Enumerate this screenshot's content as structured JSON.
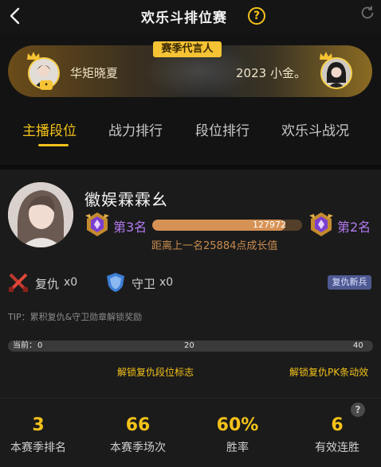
{
  "header": {
    "title": "欢乐斗排位赛"
  },
  "banner": {
    "tag": "赛季代言人",
    "left_name": "华矩晓夏",
    "right_name": "2023 小金。"
  },
  "tabs": [
    {
      "label": "主播段位",
      "active": true
    },
    {
      "label": "战力排行",
      "active": false
    },
    {
      "label": "段位排行",
      "active": false
    },
    {
      "label": "欢乐斗战况",
      "active": false
    }
  ],
  "anchor": {
    "name": "徽娱霖霖幺",
    "current_rank": "第3名",
    "next_rank": "第2名",
    "progress_value": "127972",
    "progress_fraction": 0.89,
    "gap_text": "距离上一名25884点成长值"
  },
  "stats": {
    "revenge_label": "复仇",
    "revenge_count": "x0",
    "guard_label": "守卫",
    "guard_count": "x0",
    "new_badge": "复仇新兵"
  },
  "tip": "TIP：累积复仇&守卫勋章解锁奖励",
  "track": {
    "current_label": "当前：",
    "current_value": "0",
    "mid_mark": "20",
    "end_mark": "40",
    "unlock_left": "解锁复仇段位标志",
    "unlock_right": "解锁复仇PK条动效"
  },
  "metrics": [
    {
      "value": "3",
      "label": "本赛季排名"
    },
    {
      "value": "66",
      "label": "本赛季场次"
    },
    {
      "value": "60%",
      "label": "胜率"
    },
    {
      "value": "6",
      "label": "有效连胜"
    }
  ],
  "colors": {
    "accent": "#f3c21a",
    "rank_purple": "#b27bf0",
    "progress": "#d69255",
    "badge_blue": "#4f5a93"
  },
  "icons": [
    "back-arrow-icon",
    "help-icon",
    "refresh-icon",
    "crown-icon",
    "rank-emblem-icon",
    "swords-icon",
    "shield-icon",
    "question-icon"
  ]
}
